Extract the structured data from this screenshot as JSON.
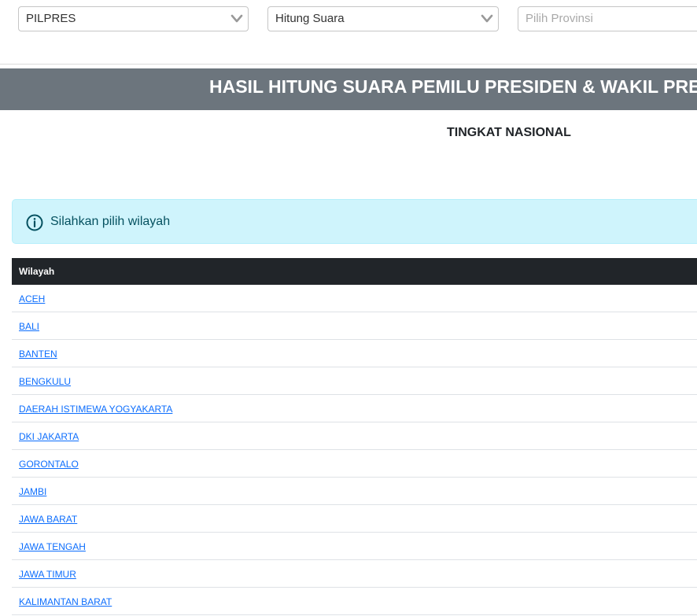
{
  "filters": {
    "election_type": "PILPRES",
    "view_type": "Hitung Suara",
    "province_placeholder": "Pilih Provinsi"
  },
  "header": {
    "title": "HASIL HITUNG SUARA PEMILU PRESIDEN & WAKIL PRESIDEN"
  },
  "level": "TINGKAT NASIONAL",
  "alert": {
    "message": "Silahkan pilih wilayah"
  },
  "table": {
    "header": "Wilayah",
    "rows": [
      "ACEH",
      "BALI",
      "BANTEN",
      "BENGKULU",
      "DAERAH ISTIMEWA YOGYAKARTA",
      "DKI JAKARTA",
      "GORONTALO",
      "JAMBI",
      "JAWA BARAT",
      "JAWA TENGAH",
      "JAWA TIMUR",
      "KALIMANTAN BARAT"
    ]
  },
  "colors": {
    "title_bar": "#6c757d",
    "alert_bg": "#cff4fc",
    "table_header": "#212529",
    "link": "#0d6efd"
  }
}
